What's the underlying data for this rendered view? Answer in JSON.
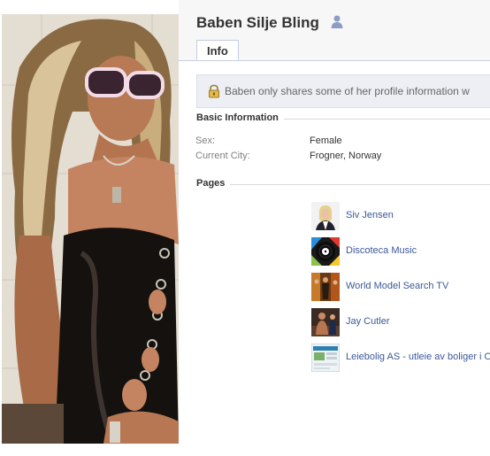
{
  "profile": {
    "name": "Baben Silje Bling"
  },
  "tabs": [
    {
      "label": "Info"
    }
  ],
  "privacy_notice": {
    "text": "Baben only shares some of her profile information w"
  },
  "basic_information": {
    "heading": "Basic Information",
    "rows": [
      {
        "label": "Sex:",
        "value": "Female"
      },
      {
        "label": "Current City:",
        "value": "Frogner, Norway"
      }
    ]
  },
  "pages": {
    "heading": "Pages",
    "items": [
      {
        "name": "Siv Jensen",
        "thumb_icon": "portrait-thumbnail"
      },
      {
        "name": "Discoteca Music",
        "thumb_icon": "vinyl-record-thumbnail"
      },
      {
        "name": "World Model Search TV",
        "thumb_icon": "model-photo-thumbnail"
      },
      {
        "name": "Jay Cutler",
        "thumb_icon": "stage-photo-thumbnail"
      },
      {
        "name": "Leiebolig AS - utleie av boliger i Os",
        "thumb_icon": "website-screenshot-thumbnail"
      }
    ]
  },
  "colors": {
    "link": "#3b5998",
    "header_band": "#f7f7f7",
    "notice_background": "#edeff4",
    "border": "#c4cde0"
  }
}
